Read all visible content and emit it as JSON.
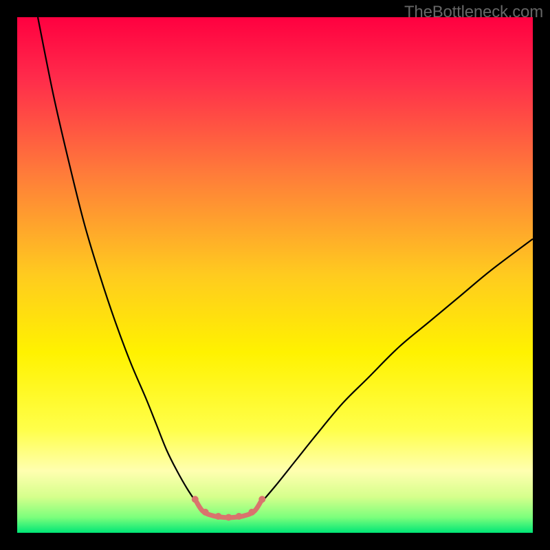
{
  "watermark": "TheBottleneck.com",
  "chart_data": {
    "type": "line",
    "title": "",
    "xlabel": "",
    "ylabel": "",
    "xlim": [
      0,
      100
    ],
    "ylim": [
      0,
      100
    ],
    "background_gradient": {
      "stops": [
        {
          "offset": 0.0,
          "color": "#ff0040"
        },
        {
          "offset": 0.12,
          "color": "#ff2c4b"
        },
        {
          "offset": 0.3,
          "color": "#ff7a3a"
        },
        {
          "offset": 0.5,
          "color": "#ffcb1f"
        },
        {
          "offset": 0.65,
          "color": "#fff200"
        },
        {
          "offset": 0.8,
          "color": "#ffff4a"
        },
        {
          "offset": 0.88,
          "color": "#ffffb0"
        },
        {
          "offset": 0.93,
          "color": "#d6ff8c"
        },
        {
          "offset": 0.97,
          "color": "#7cff7c"
        },
        {
          "offset": 1.0,
          "color": "#00e676"
        }
      ]
    },
    "series": [
      {
        "name": "left-branch",
        "color": "#000000",
        "width": 2.2,
        "points": [
          {
            "x": 4,
            "y": 100
          },
          {
            "x": 7,
            "y": 85
          },
          {
            "x": 10,
            "y": 72
          },
          {
            "x": 13,
            "y": 60
          },
          {
            "x": 16,
            "y": 50
          },
          {
            "x": 19,
            "y": 41
          },
          {
            "x": 22,
            "y": 33
          },
          {
            "x": 25,
            "y": 26
          },
          {
            "x": 27,
            "y": 21
          },
          {
            "x": 29,
            "y": 16
          },
          {
            "x": 31,
            "y": 12
          },
          {
            "x": 33,
            "y": 8.5
          },
          {
            "x": 35,
            "y": 5.5
          }
        ]
      },
      {
        "name": "right-branch",
        "color": "#000000",
        "width": 2.2,
        "points": [
          {
            "x": 47,
            "y": 5.5
          },
          {
            "x": 50,
            "y": 9
          },
          {
            "x": 54,
            "y": 14
          },
          {
            "x": 58,
            "y": 19
          },
          {
            "x": 63,
            "y": 25
          },
          {
            "x": 68,
            "y": 30
          },
          {
            "x": 74,
            "y": 36
          },
          {
            "x": 80,
            "y": 41
          },
          {
            "x": 86,
            "y": 46
          },
          {
            "x": 92,
            "y": 51
          },
          {
            "x": 100,
            "y": 57
          }
        ]
      },
      {
        "name": "highlight-bottom",
        "color": "#d9736d",
        "width": 7,
        "linecap": "round",
        "points": [
          {
            "x": 34.5,
            "y": 6.5
          },
          {
            "x": 36,
            "y": 4.2
          },
          {
            "x": 38,
            "y": 3.3
          },
          {
            "x": 40,
            "y": 3.0
          },
          {
            "x": 42,
            "y": 3.0
          },
          {
            "x": 44,
            "y": 3.3
          },
          {
            "x": 46,
            "y": 4.2
          },
          {
            "x": 47.5,
            "y": 6.5
          }
        ]
      },
      {
        "name": "highlight-dots",
        "color": "#d9736d",
        "radius": 5,
        "points": [
          {
            "x": 34.5,
            "y": 6.5
          },
          {
            "x": 36.5,
            "y": 4.0
          },
          {
            "x": 39.0,
            "y": 3.2
          },
          {
            "x": 41.0,
            "y": 3.0
          },
          {
            "x": 43.0,
            "y": 3.2
          },
          {
            "x": 45.5,
            "y": 4.0
          },
          {
            "x": 47.5,
            "y": 6.5
          }
        ]
      }
    ]
  }
}
